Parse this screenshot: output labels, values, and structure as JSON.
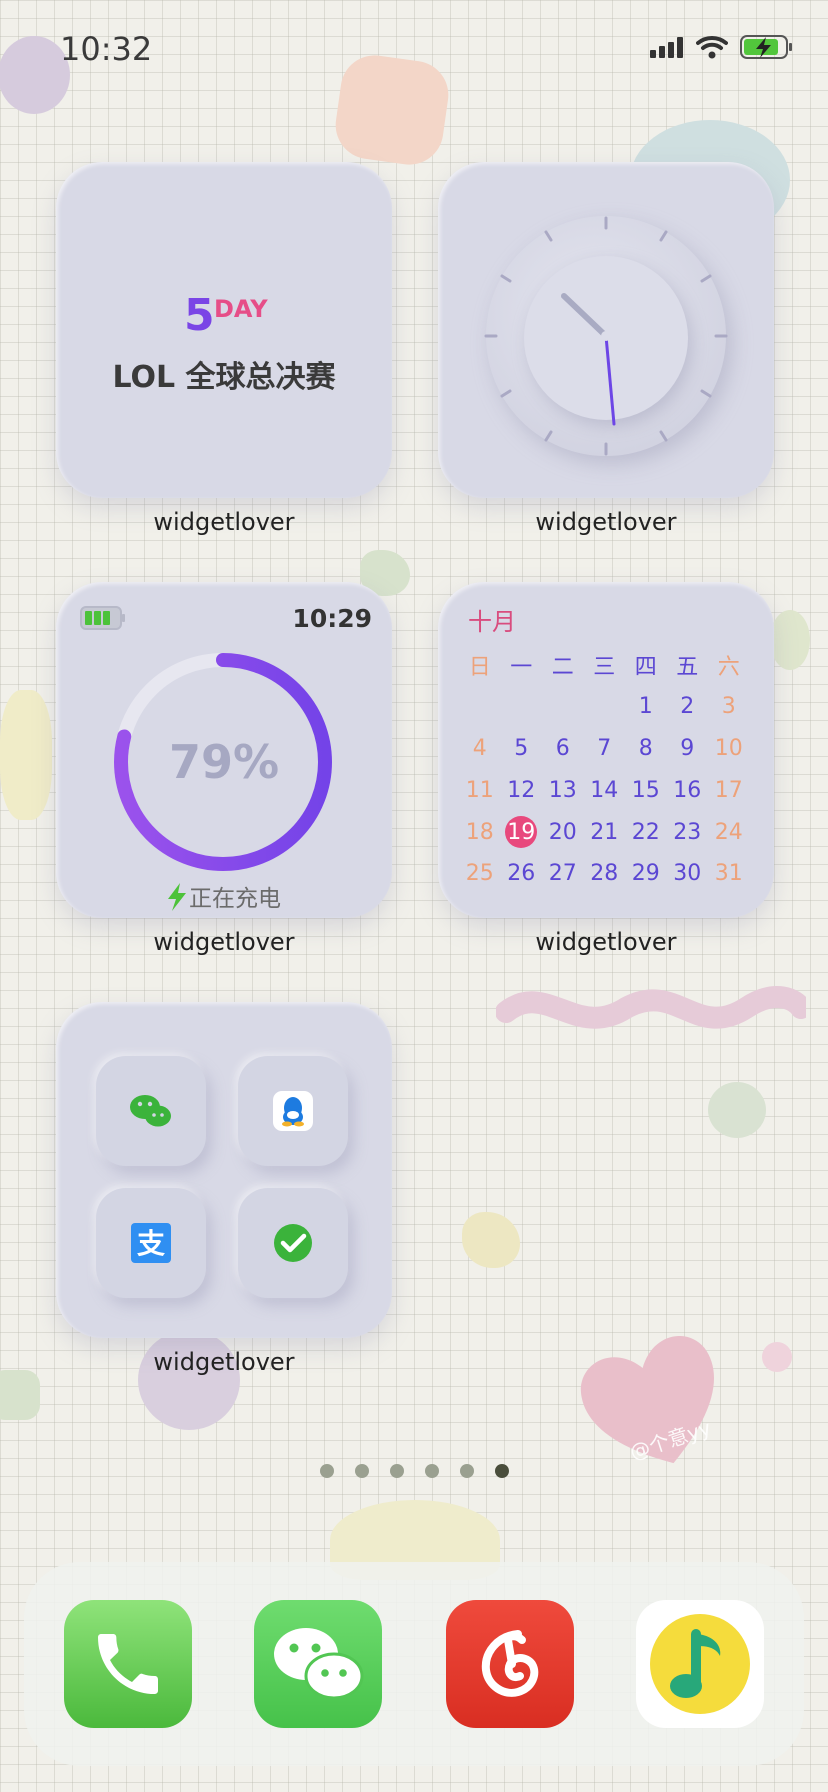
{
  "status_bar": {
    "time": "10:32"
  },
  "widgets": {
    "countdown": {
      "number": "5",
      "unit": "DAY",
      "title": "LOL 全球总决赛",
      "label": "widgetlover"
    },
    "clock": {
      "label": "widgetlover"
    },
    "battery": {
      "time": "10:29",
      "percent": "79%",
      "percent_value": 0.79,
      "charging_text": "正在充电",
      "label": "widgetlover"
    },
    "calendar": {
      "month": "十月",
      "weekdays": [
        "日",
        "一",
        "二",
        "三",
        "四",
        "五",
        "六"
      ],
      "rows": [
        [
          "",
          "",
          "",
          "",
          "1",
          "2",
          "3"
        ],
        [
          "4",
          "5",
          "6",
          "7",
          "8",
          "9",
          "10"
        ],
        [
          "11",
          "12",
          "13",
          "14",
          "15",
          "16",
          "17"
        ],
        [
          "18",
          "19",
          "20",
          "21",
          "22",
          "23",
          "24"
        ],
        [
          "25",
          "26",
          "27",
          "28",
          "29",
          "30",
          "31"
        ]
      ],
      "today": "19",
      "label": "widgetlover"
    },
    "apps": {
      "icons": [
        "wechat-icon",
        "qq-icon",
        "alipay-icon",
        "wechat-pay-icon"
      ],
      "label": "widgetlover"
    }
  },
  "watermark": "@个意yy",
  "page_dots": {
    "count": 6,
    "active": 6
  },
  "dock": {
    "apps": [
      "phone-icon",
      "wechat-icon",
      "netease-music-icon",
      "qq-music-icon"
    ]
  },
  "colors": {
    "accent_purple": "#7a45e6",
    "accent_pink": "#e8497d",
    "widget_bg": "#d8d9e6"
  }
}
